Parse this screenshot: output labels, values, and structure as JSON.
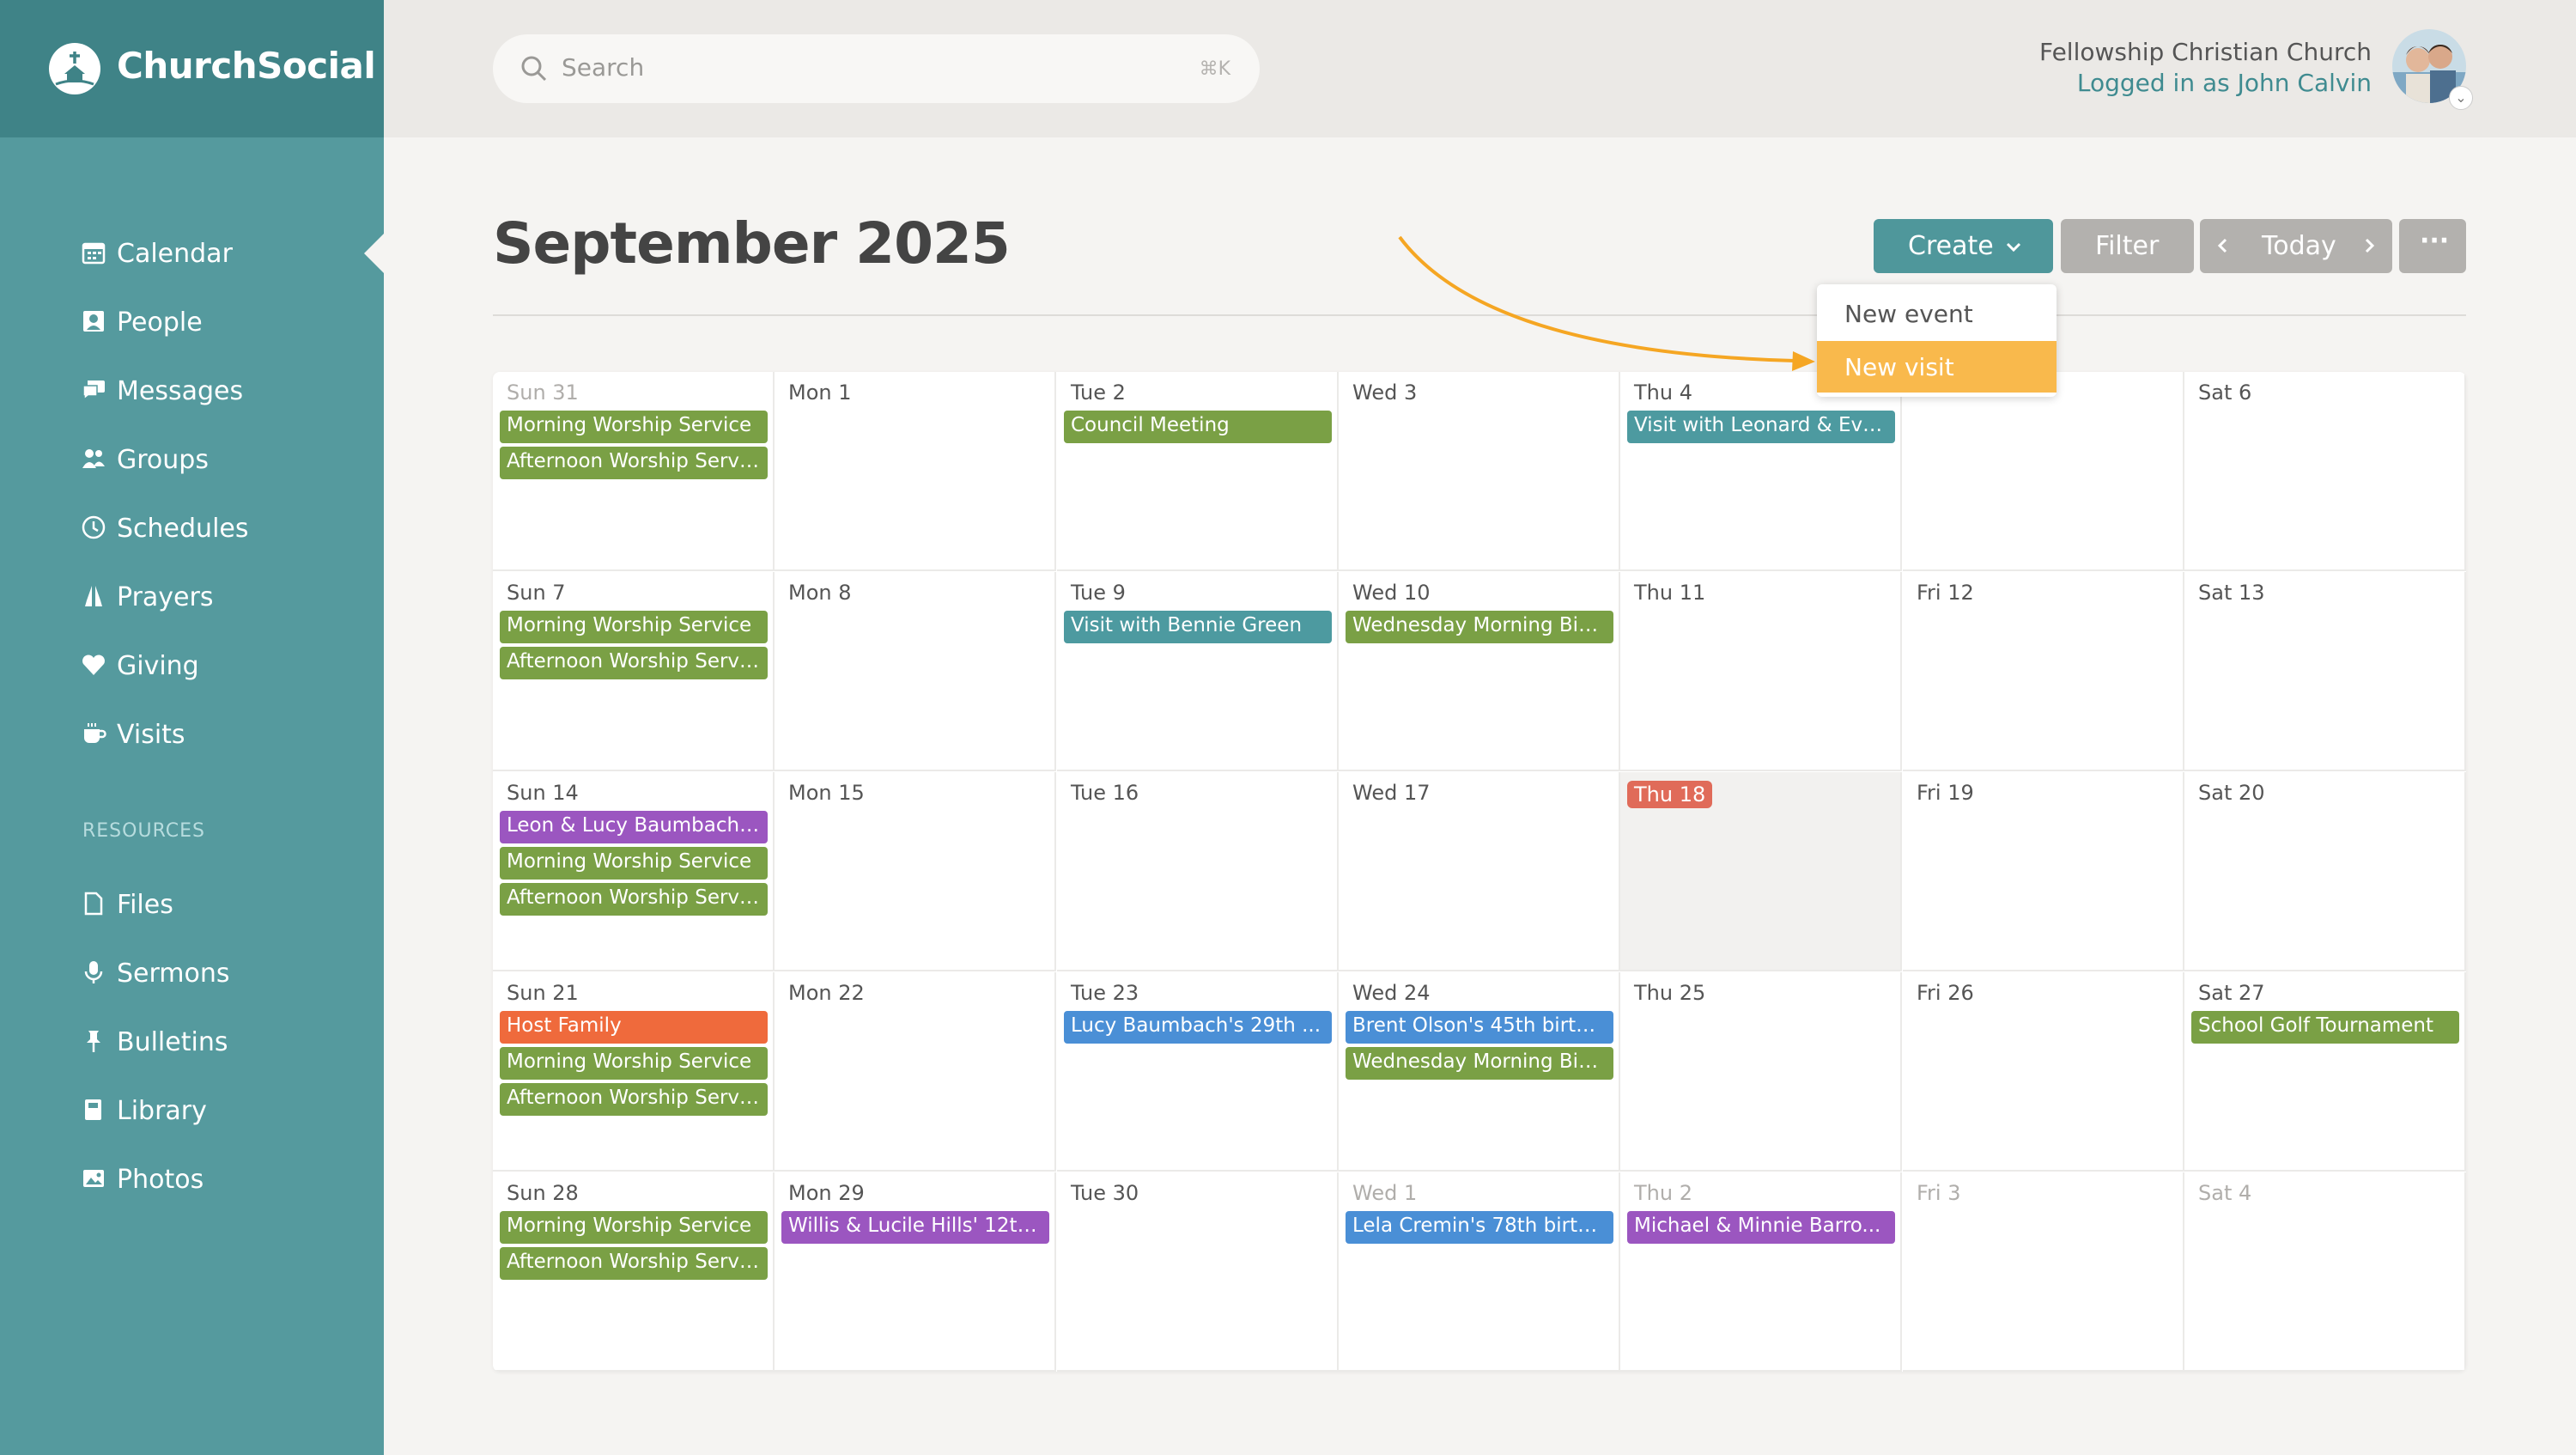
{
  "app": {
    "name": "ChurchSocial"
  },
  "sidebar": {
    "items": [
      {
        "label": "Calendar",
        "icon": "calendar-icon"
      },
      {
        "label": "People",
        "icon": "people-icon"
      },
      {
        "label": "Messages",
        "icon": "messages-icon"
      },
      {
        "label": "Groups",
        "icon": "groups-icon"
      },
      {
        "label": "Schedules",
        "icon": "clock-icon"
      },
      {
        "label": "Prayers",
        "icon": "praying-hands-icon"
      },
      {
        "label": "Giving",
        "icon": "heart-icon"
      },
      {
        "label": "Visits",
        "icon": "coffee-cup-icon"
      }
    ],
    "resources_heading": "RESOURCES",
    "resources": [
      {
        "label": "Files",
        "icon": "file-icon"
      },
      {
        "label": "Sermons",
        "icon": "microphone-icon"
      },
      {
        "label": "Bulletins",
        "icon": "pushpin-icon"
      },
      {
        "label": "Library",
        "icon": "book-icon"
      },
      {
        "label": "Photos",
        "icon": "photo-icon"
      }
    ]
  },
  "header": {
    "search_placeholder": "Search",
    "search_shortcut": "⌘K",
    "org_name": "Fellowship Christian Church",
    "login_text": "Logged in as John Calvin"
  },
  "page": {
    "title": "September 2025",
    "create_label": "Create",
    "filter_label": "Filter",
    "today_label": "Today",
    "more_label": "···"
  },
  "dropdown": {
    "items": [
      "New event",
      "New visit"
    ],
    "highlighted": "New visit"
  },
  "colors": {
    "sidebar": "#559a9e",
    "sidebar_header": "#3f8387",
    "accent": "#4f979b",
    "highlight": "#f9b94c",
    "today": "#e06b59",
    "event_green": "#7aa045",
    "event_teal": "#4d9aa0",
    "event_purple": "#9b56c0",
    "event_blue": "#4a8fd6",
    "event_orange": "#ef6a3c"
  },
  "calendar": {
    "weeks": [
      [
        {
          "date": "Sun 31",
          "muted": true,
          "events": [
            {
              "title": "Morning Worship Service",
              "color": "green"
            },
            {
              "title": "Afternoon Worship Servi...",
              "color": "green"
            }
          ]
        },
        {
          "date": "Mon 1",
          "events": []
        },
        {
          "date": "Tue 2",
          "events": [
            {
              "title": "Council Meeting",
              "color": "green"
            }
          ]
        },
        {
          "date": "Wed 3",
          "events": []
        },
        {
          "date": "Thu 4",
          "events": [
            {
              "title": "Visit with Leonard & Eve...",
              "color": "teal"
            }
          ]
        },
        {
          "date": "",
          "events": []
        },
        {
          "date": "Sat 6",
          "events": []
        }
      ],
      [
        {
          "date": "Sun 7",
          "events": [
            {
              "title": "Morning Worship Service",
              "color": "green"
            },
            {
              "title": "Afternoon Worship Servi...",
              "color": "green"
            }
          ]
        },
        {
          "date": "Mon 8",
          "events": []
        },
        {
          "date": "Tue 9",
          "events": [
            {
              "title": "Visit with Bennie Green",
              "color": "teal"
            }
          ]
        },
        {
          "date": "Wed 10",
          "events": [
            {
              "title": "Wednesday Morning Bib...",
              "color": "green"
            }
          ]
        },
        {
          "date": "Thu 11",
          "events": []
        },
        {
          "date": "Fri 12",
          "events": []
        },
        {
          "date": "Sat 13",
          "events": []
        }
      ],
      [
        {
          "date": "Sun 14",
          "events": [
            {
              "title": "Leon & Lucy Baumbach'...",
              "color": "purple"
            },
            {
              "title": "Morning Worship Service",
              "color": "green"
            },
            {
              "title": "Afternoon Worship Servi...",
              "color": "green"
            }
          ]
        },
        {
          "date": "Mon 15",
          "events": []
        },
        {
          "date": "Tue 16",
          "events": []
        },
        {
          "date": "Wed 17",
          "events": []
        },
        {
          "date": "Thu 18",
          "today": true,
          "events": []
        },
        {
          "date": "Fri 19",
          "events": []
        },
        {
          "date": "Sat 20",
          "events": []
        }
      ],
      [
        {
          "date": "Sun 21",
          "events": [
            {
              "title": "Host Family",
              "color": "orange"
            },
            {
              "title": "Morning Worship Service",
              "color": "green"
            },
            {
              "title": "Afternoon Worship Servi...",
              "color": "green"
            }
          ]
        },
        {
          "date": "Mon 22",
          "events": []
        },
        {
          "date": "Tue 23",
          "events": [
            {
              "title": "Lucy Baumbach's 29th ...",
              "color": "blue"
            }
          ]
        },
        {
          "date": "Wed 24",
          "events": [
            {
              "title": "Brent Olson's 45th birth...",
              "color": "blue"
            },
            {
              "title": "Wednesday Morning Bib...",
              "color": "green"
            }
          ]
        },
        {
          "date": "Thu 25",
          "events": []
        },
        {
          "date": "Fri 26",
          "events": []
        },
        {
          "date": "Sat 27",
          "events": [
            {
              "title": "School Golf Tournament",
              "color": "green"
            }
          ]
        }
      ],
      [
        {
          "date": "Sun 28",
          "events": [
            {
              "title": "Morning Worship Service",
              "color": "green"
            },
            {
              "title": "Afternoon Worship Servi...",
              "color": "green"
            }
          ]
        },
        {
          "date": "Mon 29",
          "events": [
            {
              "title": "Willis & Lucile Hills' 12th...",
              "color": "purple"
            }
          ]
        },
        {
          "date": "Tue 30",
          "events": []
        },
        {
          "date": "Wed 1",
          "muted": true,
          "events": [
            {
              "title": "Lela Cremin's 78th birth...",
              "color": "blue"
            }
          ]
        },
        {
          "date": "Thu 2",
          "muted": true,
          "events": [
            {
              "title": "Michael & Minnie Barro...",
              "color": "purple"
            }
          ]
        },
        {
          "date": "Fri 3",
          "muted": true,
          "events": []
        },
        {
          "date": "Sat 4",
          "muted": true,
          "events": []
        }
      ]
    ]
  }
}
